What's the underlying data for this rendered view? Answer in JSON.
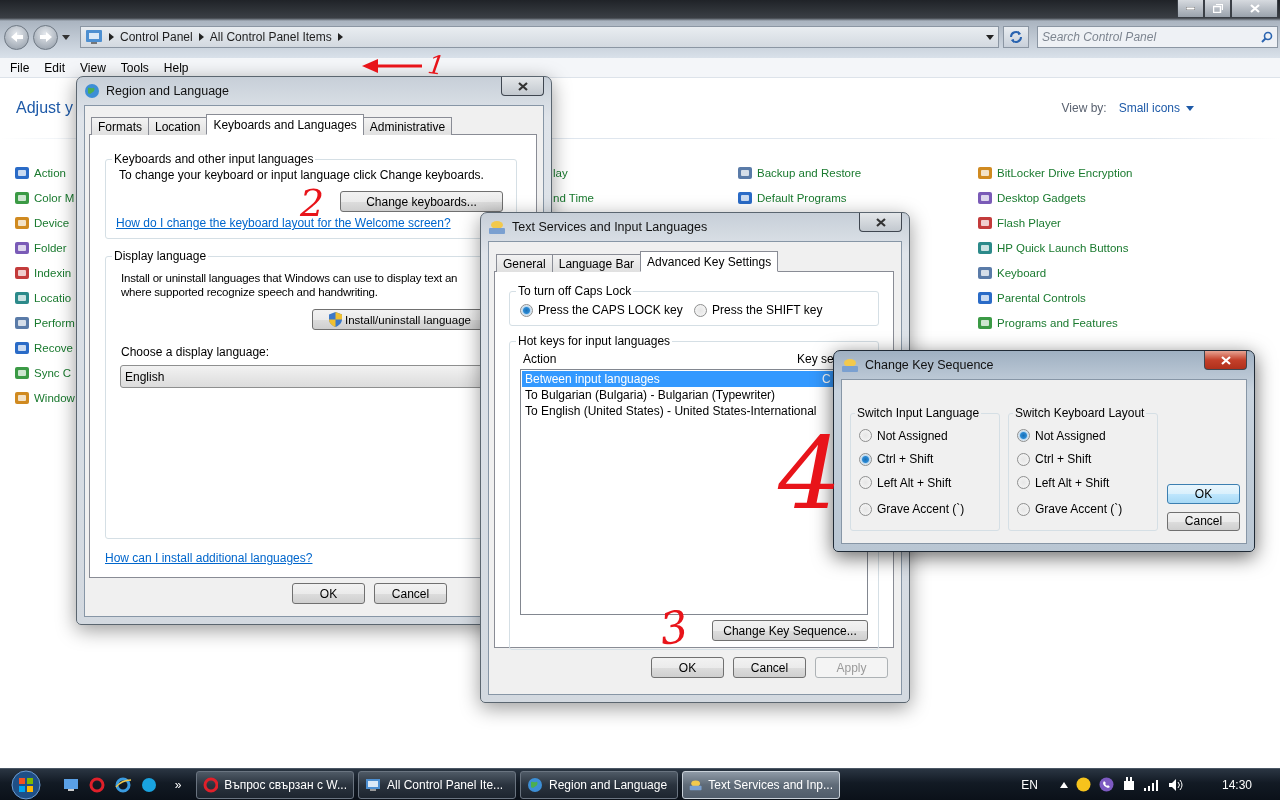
{
  "explorer": {
    "breadcrumb": [
      "Control Panel",
      "All Control Panel Items"
    ],
    "search": {
      "placeholder": "Search Control Panel"
    },
    "menu": [
      "File",
      "Edit",
      "View",
      "Tools",
      "Help"
    ],
    "heading": "Adjust y",
    "view_by_label": "View by:",
    "view_by_value": "Small icons",
    "columns": [
      {
        "show_icons": true,
        "items": [
          "Action",
          "Color M",
          "Device",
          "Folder",
          "Indexin",
          "Locatio",
          "Perform",
          "Recove",
          "Sync C",
          "Window"
        ]
      },
      {
        "show_icons": false,
        "items": [
          "lay",
          "nd Time"
        ]
      },
      {
        "show_icons": true,
        "items": [
          "Backup and Restore",
          "Default Programs"
        ]
      },
      {
        "show_icons": true,
        "items": [
          "BitLocker Drive Encryption",
          "Desktop Gadgets",
          "Flash Player",
          "HP Quick Launch Buttons",
          "Keyboard",
          "Parental Controls",
          "Programs and Features"
        ]
      }
    ]
  },
  "region_dialog": {
    "title": "Region and Language",
    "active": false,
    "tabs": [
      {
        "label": "Formats",
        "selected": false
      },
      {
        "label": "Location",
        "selected": false
      },
      {
        "label": "Keyboards and Languages",
        "selected": true
      },
      {
        "label": "Administrative",
        "selected": false
      }
    ],
    "keyboards_group": {
      "legend": "Keyboards and other input languages",
      "text": "To change your keyboard or input language click Change keyboards.",
      "button": "Change keyboards...",
      "link": "How do I change the keyboard layout for the Welcome screen?"
    },
    "display_group": {
      "legend": "Display language",
      "lines": [
        "Install or uninstall languages that Windows can use to display text an",
        "where supported recognize speech and handwriting."
      ],
      "button": "Install/uninstall language",
      "label": "Choose a display language:",
      "value": "English"
    },
    "link": "How can I install additional languages?",
    "buttons": [
      {
        "label": "OK",
        "disabled": false
      },
      {
        "label": "Cancel",
        "disabled": false
      }
    ]
  },
  "text_services_dialog": {
    "title": "Text Services and Input Languages",
    "active": false,
    "tabs": [
      {
        "label": "General",
        "selected": false
      },
      {
        "label": "Language Bar",
        "selected": false
      },
      {
        "label": "Advanced Key Settings",
        "selected": true
      }
    ],
    "caps_group": {
      "legend": "To turn off Caps Lock",
      "options": [
        {
          "label": "Press the CAPS LOCK key",
          "selected": true
        },
        {
          "label": "Press the SHIFT key",
          "selected": false
        }
      ]
    },
    "hotkeys_group": {
      "legend": "Hot keys for input languages",
      "columns": [
        "Action",
        "Key se"
      ],
      "rows": [
        {
          "action": "Between input languages",
          "key": "C",
          "selected": true
        },
        {
          "action": "To Bulgarian (Bulgaria) - Bulgarian (Typewriter)",
          "selected": false
        },
        {
          "action": "To English (United States) - United States-International",
          "selected": false
        }
      ],
      "button": "Change Key Sequence..."
    },
    "buttons": [
      {
        "label": "OK",
        "disabled": false
      },
      {
        "label": "Cancel",
        "disabled": false
      },
      {
        "label": "Apply",
        "disabled": true
      }
    ]
  },
  "key_sequence_dialog": {
    "title": "Change Key Sequence",
    "active": true,
    "groups": [
      {
        "legend": "Switch Input Language",
        "options": [
          {
            "label": "Not Assigned",
            "selected": false
          },
          {
            "label": "Ctrl + Shift",
            "selected": true
          },
          {
            "label": "Left Alt + Shift",
            "selected": false
          },
          {
            "label": "Grave Accent (`)",
            "selected": false
          }
        ]
      },
      {
        "legend": "Switch Keyboard Layout",
        "options": [
          {
            "label": "Not Assigned",
            "selected": true
          },
          {
            "label": "Ctrl + Shift",
            "selected": false
          },
          {
            "label": "Left Alt + Shift",
            "selected": false
          },
          {
            "label": "Grave Accent (`)",
            "selected": false
          }
        ]
      }
    ],
    "buttons": [
      {
        "label": "OK",
        "focused": true
      },
      {
        "label": "Cancel",
        "focused": false
      }
    ]
  },
  "annotations": [
    {
      "kind": "arrow"
    },
    {
      "kind": "number",
      "text": "1"
    },
    {
      "kind": "number",
      "text": "2"
    },
    {
      "kind": "number",
      "text": "3"
    },
    {
      "kind": "number",
      "text": "4"
    }
  ],
  "taskbar": {
    "overflow": "»",
    "tasks": [
      {
        "kind": "browser",
        "label": "Въпрос свързан с W...",
        "selected": false
      },
      {
        "kind": "panel",
        "label": "All Control Panel Ite...",
        "selected": false
      },
      {
        "kind": "globe",
        "label": "Region and Language",
        "selected": false
      },
      {
        "kind": "keyboard",
        "label": "Text Services and Inp...",
        "selected": true
      }
    ],
    "language": "EN",
    "clock": "14:30"
  }
}
